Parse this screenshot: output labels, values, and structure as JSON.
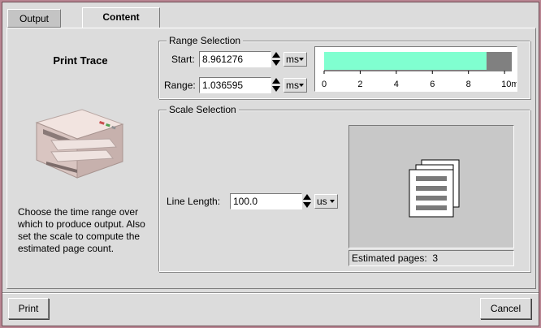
{
  "tabs": [
    {
      "label": "Output",
      "active": false
    },
    {
      "label": "Content",
      "active": true
    }
  ],
  "left_panel": {
    "title": "Print Trace",
    "description": "Choose the time range over which to produce output. Also set the scale to compute the estimated page count.",
    "image": "printer-icon"
  },
  "range_selection": {
    "legend": "Range Selection",
    "start": {
      "label": "Start:",
      "value": "8.961276",
      "unit": "ms"
    },
    "range": {
      "label": "Range:",
      "value": "1.036595",
      "unit": "ms"
    },
    "axis_ticks": [
      "0",
      "2",
      "4",
      "6",
      "8",
      "10ms"
    ],
    "axis_max": 10.4,
    "selection_end": 9.0,
    "selected_start": 8.961276,
    "selected_length": 1.036595,
    "bar_color": "#80ffd0",
    "selected_color": "#808080"
  },
  "scale_selection": {
    "legend": "Scale Selection",
    "line_length": {
      "label": "Line Length:",
      "value": "100.0",
      "unit": "us"
    },
    "estimated_pages_label": "Estimated pages:",
    "estimated_pages_value": "3",
    "preview_icon": "pages-stack-icon"
  },
  "buttons": {
    "print": "Print",
    "cancel": "Cancel"
  }
}
